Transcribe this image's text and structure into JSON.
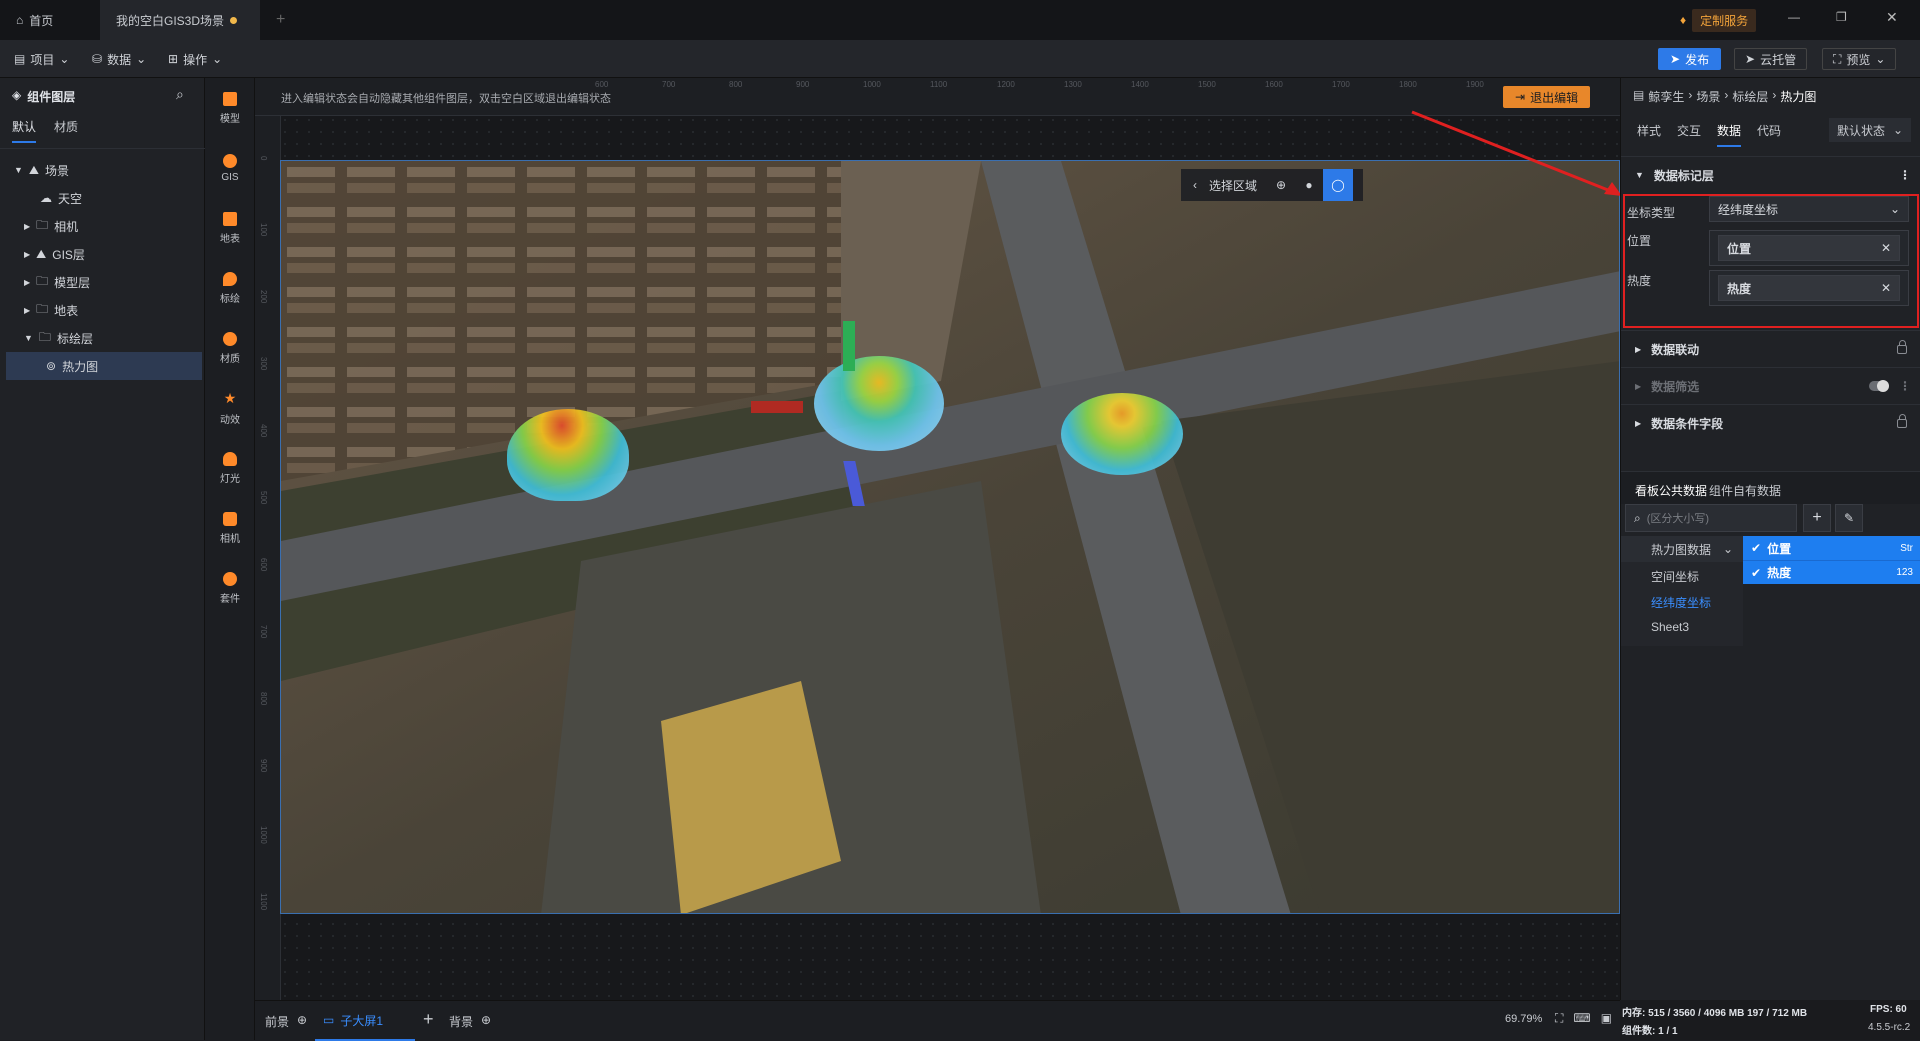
{
  "tabs": [
    {
      "label": "首页"
    },
    {
      "label": "我的空白GIS3D场景"
    }
  ],
  "custom_service": "定制服务",
  "toolbar": {
    "project": "项目",
    "data": "数据",
    "operation": "操作",
    "publish": "发布",
    "cloud": "云托管",
    "preview": "预览"
  },
  "left_panel": {
    "title": "组件图层",
    "tabs": [
      "默认",
      "材质"
    ],
    "tree": [
      {
        "label": "场景",
        "indent": 0
      },
      {
        "label": "天空",
        "indent": 1
      },
      {
        "label": "相机",
        "indent": 1
      },
      {
        "label": "GIS层",
        "indent": 1
      },
      {
        "label": "模型层",
        "indent": 1
      },
      {
        "label": "地表",
        "indent": 1
      },
      {
        "label": "标绘层",
        "indent": 1
      },
      {
        "label": "热力图",
        "indent": 2
      }
    ]
  },
  "icon_column": [
    "模型",
    "GIS",
    "地表",
    "标绘",
    "材质",
    "动效",
    "灯光",
    "相机",
    "套件"
  ],
  "canvas": {
    "hint": "进入编辑状态会自动隐藏其他组件图层，双击空白区域退出编辑状态",
    "exit_edit": "退出编辑",
    "select_area": "选择区域",
    "ruler_top": [
      "600",
      "700",
      "800",
      "900",
      "1000",
      "1100",
      "1200",
      "1300",
      "1400",
      "1500",
      "1600",
      "1700",
      "1800",
      "1900"
    ],
    "ruler_left": [
      "0",
      "100",
      "200",
      "300",
      "400",
      "500",
      "600",
      "700",
      "800",
      "900",
      "1000",
      "1100"
    ]
  },
  "right_panel": {
    "breadcrumb": [
      "鲸孪生",
      "场景",
      "标绘层",
      "热力图"
    ],
    "tabs": [
      "样式",
      "交互",
      "数据",
      "代码"
    ],
    "state": "默认状态",
    "section_data_marker": "数据标记层",
    "coord_type_label": "坐标类型",
    "coord_type_value": "经纬度坐标",
    "position_label": "位置",
    "position_value": "位置",
    "heat_label": "热度",
    "heat_value": "热度",
    "section_linkage": "数据联动",
    "section_filter": "数据筛选",
    "section_condition": "数据条件字段",
    "data_tabs": [
      "看板公共数据",
      "组件自有数据"
    ],
    "search_placeholder": "(区分大小写)",
    "datasets": [
      "热力图数据",
      "空间坐标",
      "经纬度坐标",
      "Sheet3"
    ],
    "fields": [
      {
        "name": "位置",
        "type": "Str"
      },
      {
        "name": "热度",
        "type": "123"
      }
    ]
  },
  "bottom": {
    "foreground": "前景",
    "sub_screen": "子大屏1",
    "background": "背景",
    "zoom": "69.79%"
  },
  "status": {
    "memory": "内存: 515 / 3560 / 4096 MB  197 / 712 MB",
    "fps": "FPS: 60",
    "components": "组件数: 1 / 1",
    "version": "4.5.5-rc.2"
  }
}
